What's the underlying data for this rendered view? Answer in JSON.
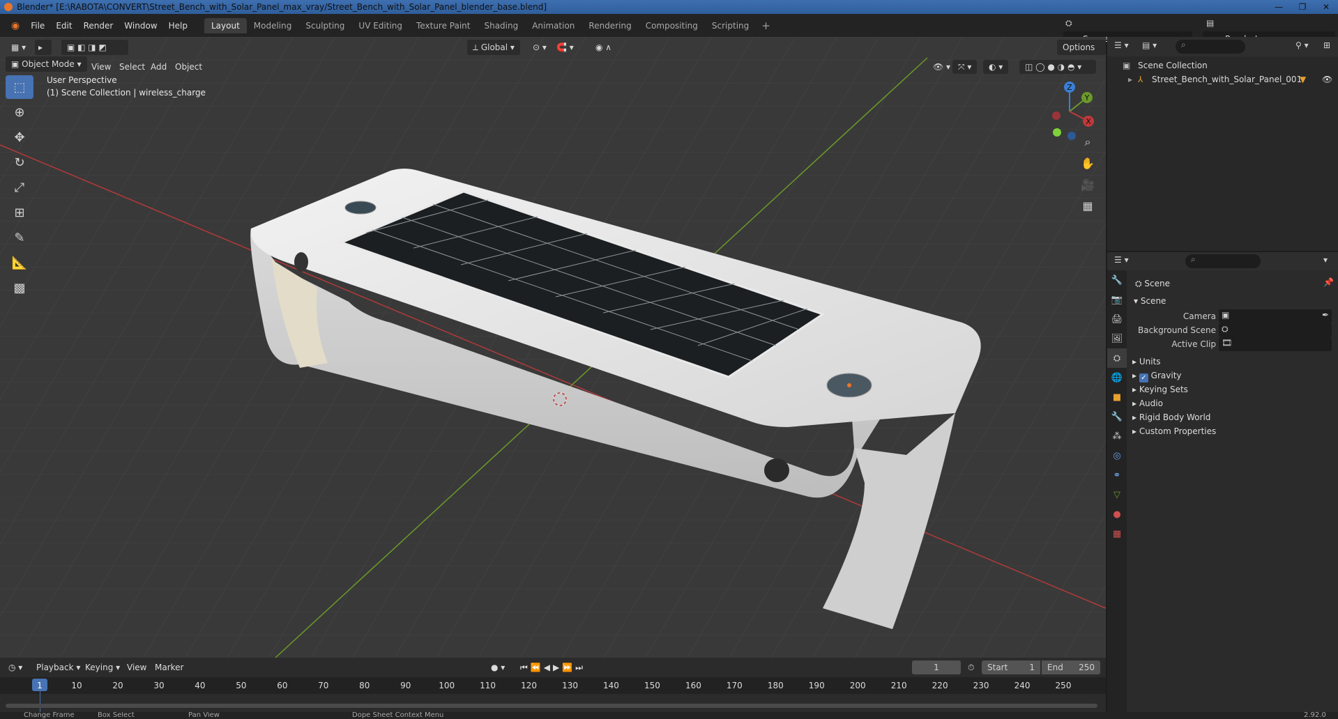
{
  "window": {
    "title": "Blender* [E:\\RABOTA\\CONVERT\\Street_Bench_with_Solar_Panel_max_vray/Street_Bench_with_Solar_Panel_blender_base.blend]",
    "controls": [
      "—",
      "❐",
      "✕"
    ]
  },
  "menubar": {
    "menus": [
      "File",
      "Edit",
      "Render",
      "Window",
      "Help"
    ],
    "workspaces": [
      "Layout",
      "Modeling",
      "Sculpting",
      "UV Editing",
      "Texture Paint",
      "Shading",
      "Animation",
      "Rendering",
      "Compositing",
      "Scripting"
    ],
    "active_workspace": "Layout",
    "add_workspace": "+",
    "scene": "Scene",
    "view_layer": "RenderLayer"
  },
  "viewport": {
    "mode": "Object Mode",
    "menus": [
      "View",
      "Select",
      "Add",
      "Object"
    ],
    "transform_orientation": "Global",
    "options_label": "Options",
    "overlay_line1": "User Perspective",
    "overlay_line2": "(1) Scene Collection | wireless_charge",
    "gizmo": {
      "x": "X",
      "y": "Y",
      "z": "Z"
    },
    "colors": {
      "background": "#393939",
      "x_axis": "#c0393b",
      "y_axis": "#6b9a2a",
      "z_axis": "#3a7fd6",
      "accent": "#4772b3"
    }
  },
  "outliner": {
    "root": "Scene Collection",
    "items": [
      {
        "label": "Street_Bench_with_Solar_Panel_001"
      }
    ]
  },
  "properties": {
    "context_title": "Scene",
    "panel_title": "Scene",
    "fields": [
      {
        "label": "Camera"
      },
      {
        "label": "Background Scene"
      },
      {
        "label": "Active Clip"
      }
    ],
    "sections": [
      "Units",
      "Gravity",
      "Keying Sets",
      "Audio",
      "Rigid Body World",
      "Custom Properties"
    ],
    "gravity_checked": true
  },
  "timeline": {
    "menus": [
      "Playback",
      "Keying",
      "View",
      "Marker"
    ],
    "current_frame": "1",
    "start_label": "Start",
    "start": "1",
    "end_label": "End",
    "end": "250",
    "ticks": [
      "1",
      "10",
      "20",
      "30",
      "40",
      "50",
      "60",
      "70",
      "80",
      "90",
      "100",
      "110",
      "120",
      "130",
      "140",
      "150",
      "160",
      "170",
      "180",
      "190",
      "200",
      "210",
      "220",
      "230",
      "240",
      "250"
    ]
  },
  "statusbar": {
    "items": [
      "Change Frame",
      "Box Select",
      "Pan View",
      "Dope Sheet Context Menu"
    ],
    "version": "2.92.0"
  }
}
